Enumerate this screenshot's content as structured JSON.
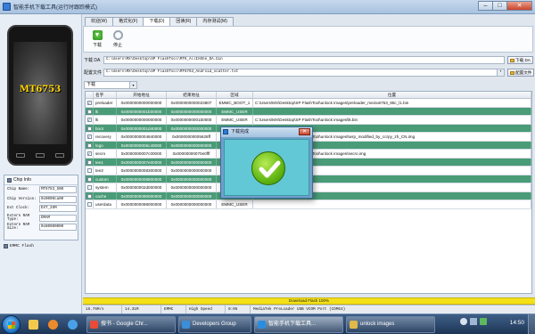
{
  "window": {
    "title": "智能手机下载工具(运行时跟踪模式)",
    "controls": [
      "–",
      "□",
      "✕"
    ]
  },
  "phone": {
    "chip_label": "MT6753"
  },
  "chip_info": {
    "title": "Chip Info",
    "rows": [
      {
        "key": "Chip Name:",
        "value": "MT6753_S00"
      },
      {
        "key": "Chip Version:",
        "value": "0x0000ca00"
      },
      {
        "key": "Ext Clock:",
        "value": "EXT_26M"
      },
      {
        "key": "Extern RAM Type:",
        "value": "DRAM"
      },
      {
        "key": "Extern RAM Size:",
        "value": "0x80000000"
      }
    ],
    "emmc_label": "EMMC Flash"
  },
  "tabs": [
    "欢迎(W)",
    "格式化(F)",
    "下载(D)",
    "回读(R)",
    "内存测试(M)"
  ],
  "active_tab": 2,
  "toolbar": {
    "download_label": "下载",
    "stop_label": "停止"
  },
  "download_agent": {
    "label": "下载 DA",
    "path": "C:\\Users\\MX\\Desktop\\SP FlashTool\\MTK_AllInOne_DA.bin",
    "button": "下载 DA"
  },
  "scatter": {
    "label": "配置文件",
    "path": "C:\\Users\\MX\\Desktop\\SP FlashTool\\MT6753_Android_scatter.txt",
    "button": "配置文件"
  },
  "mode_select": {
    "value": "下载",
    "arrow": "▾"
  },
  "table": {
    "columns": [
      "",
      "名字",
      "开始地址",
      "结束地址",
      "区域",
      "位置"
    ],
    "rows": [
      {
        "checked": true,
        "name": "preloader",
        "begin": "0x0000000000000000",
        "end": "0x0000000000023807",
        "region": "EMMC_BOOT_1",
        "location": "C:\\Users\\MX\\Desktop\\SP FlashTool\\unlock images\\preloader_meizu6753_65c_l1.bin",
        "highlight": false
      },
      {
        "checked": false,
        "name": "lk",
        "begin": "0x0000000001b00000",
        "end": "0x0000000000000000",
        "region": "EMMC_USER",
        "location": "",
        "highlight": true
      },
      {
        "checked": true,
        "name": "lk",
        "begin": "0x0000000000000000",
        "end": "0x00000000001b0000",
        "region": "EMMC_USER",
        "location": "C:\\Users\\MX\\Desktop\\SP FlashTool\\unlock images\\lk.bin",
        "highlight": false
      },
      {
        "checked": false,
        "name": "boot",
        "begin": "0x0000000001d40000",
        "end": "0x0000000000000000",
        "region": "EMMC_USER",
        "location": "",
        "highlight": true
      },
      {
        "checked": true,
        "name": "recovery",
        "begin": "0x0000000004840000",
        "end": "0x00000000005628ff",
        "region": "EMMC_USER",
        "location": "C:\\Users\\MX\\Desktop\\SP FlashTool\\unlock images\\twrp_modified_by_ccrpy_zh_CN.img",
        "highlight": false
      },
      {
        "checked": false,
        "name": "logo",
        "begin": "0x0000000005c40000",
        "end": "0x0000000000000000",
        "region": "EMMC_USER",
        "location": "",
        "highlight": true
      },
      {
        "checked": true,
        "name": "secro",
        "begin": "0x0000000007c00000",
        "end": "0x00000000070e0fff",
        "region": "EMMC_USER",
        "location": "C:\\Users\\MX\\Desktop\\SP FlashTool\\unlock images\\secro.img",
        "highlight": false
      },
      {
        "checked": false,
        "name": "tee1",
        "begin": "0x0000000007e00000",
        "end": "0x0000000000000000",
        "region": "EMMC_USER",
        "location": "",
        "highlight": true
      },
      {
        "checked": false,
        "name": "tee2",
        "begin": "0x0000000008300000",
        "end": "0x0000000000000000",
        "region": "EMMC_USER",
        "location": "",
        "highlight": false
      },
      {
        "checked": false,
        "name": "custom",
        "begin": "0x0000000008800000",
        "end": "0x0000000000000000",
        "region": "EMMC_USER",
        "location": "",
        "highlight": true
      },
      {
        "checked": false,
        "name": "system",
        "begin": "0x000000002d000000",
        "end": "0x0000000000000000",
        "region": "EMMC_USER",
        "location": "",
        "highlight": false
      },
      {
        "checked": false,
        "name": "cache",
        "begin": "0x0000000090000000",
        "end": "0x0000000000000000",
        "region": "EMMC_USER",
        "location": "",
        "highlight": true
      },
      {
        "checked": false,
        "name": "userdata",
        "begin": "0x0000000098000000",
        "end": "0x0000000000000000",
        "region": "EMMC_USER",
        "location": "",
        "highlight": false
      }
    ]
  },
  "progress": {
    "text": "Download Flash 100%",
    "percent": 100
  },
  "status": [
    "15.75M/s",
    "14.31M",
    "EMMC",
    "High Speed",
    "0:05",
    "MediaTek PreLoader USB VCOM Port (COM53)"
  ],
  "dialog": {
    "title": "下载完成",
    "close": "✕"
  },
  "taskbar": {
    "tasks": [
      {
        "label": "搜书 - Google Chr...",
        "color": "#e94b35"
      },
      {
        "label": "Developers Group",
        "color": "#3b8ed8"
      },
      {
        "label": "智能手机下载工具...",
        "color": "#2a8ee0"
      },
      {
        "label": "unlock images",
        "color": "#e0b94a"
      }
    ],
    "clock": "14:50"
  },
  "colors": {
    "highlight_row": "#4a9b77",
    "progress": "#f3e018",
    "dialog_body": "#63c8d6",
    "check": "#62b713"
  }
}
